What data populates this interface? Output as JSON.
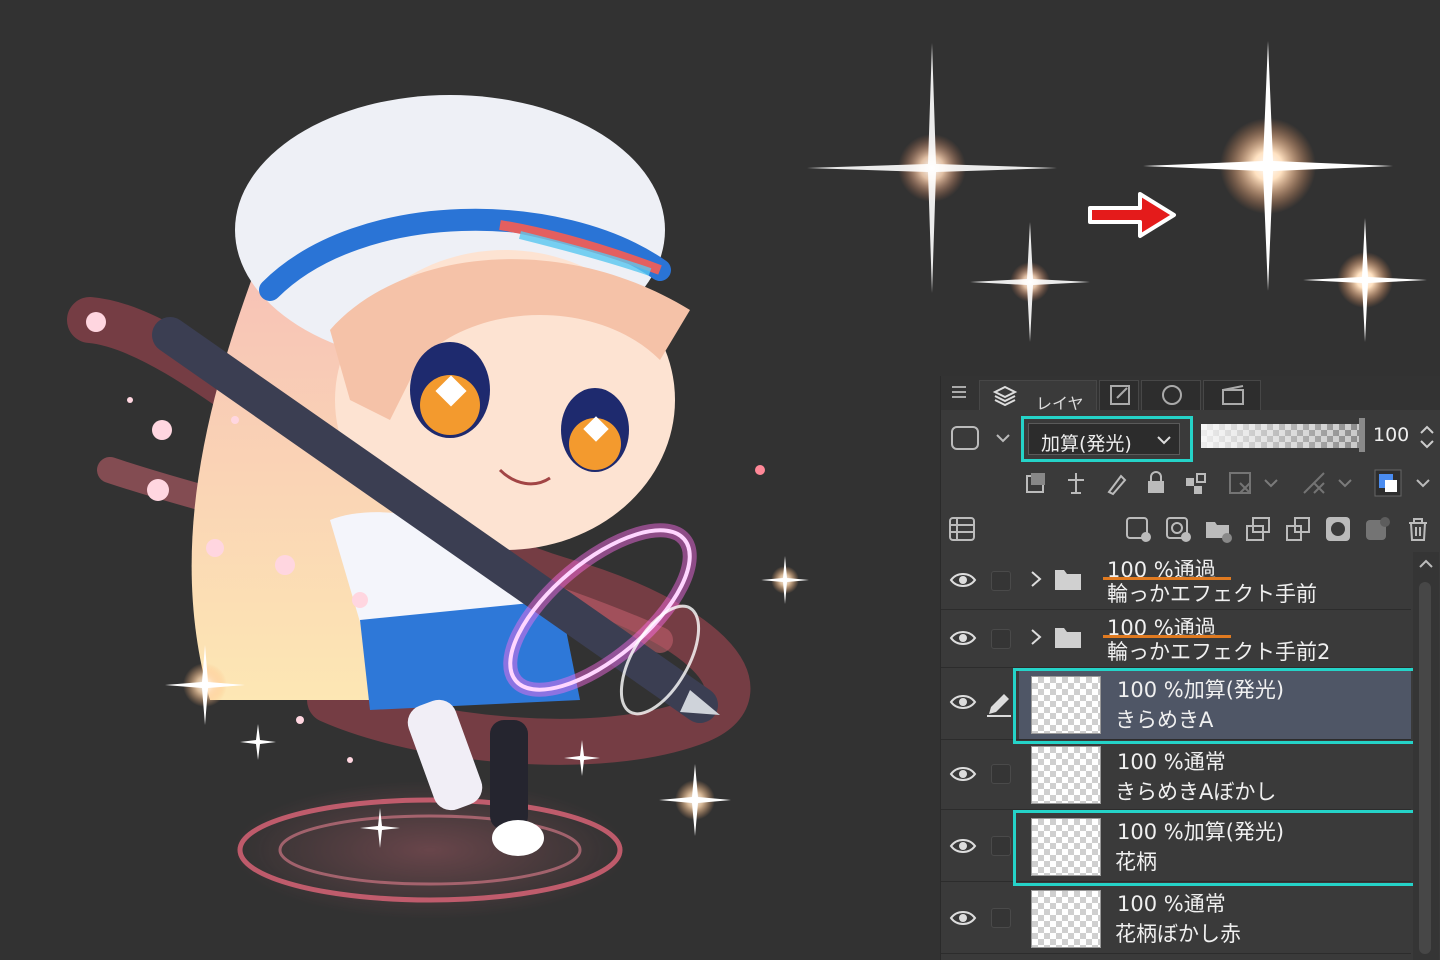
{
  "panel": {
    "tabs": [
      {
        "label": "レイヤー",
        "icon": "layers-icon"
      },
      {
        "label": "",
        "icon": "edit-icon"
      },
      {
        "label": "",
        "icon": "navigator-icon"
      },
      {
        "label": "",
        "icon": "timeline-icon"
      }
    ],
    "blend_mode": "加算(発光)",
    "opacity": "100",
    "colors": {
      "highlight": "#25d3c8",
      "underline": "#e07a20",
      "selected_row": "#4f5666"
    }
  },
  "layers": [
    {
      "type": "folder",
      "line1": "100 %通過",
      "line2": "輪っかエフェクト手前",
      "selected": false,
      "highlighted": false
    },
    {
      "type": "folder",
      "line1": "100 %通過",
      "line2": "輪っかエフェクト手前2",
      "selected": false,
      "highlighted": false
    },
    {
      "type": "raster",
      "line1": "100 %加算(発光)",
      "line2": "きらめきA",
      "selected": true,
      "highlighted": true
    },
    {
      "type": "raster",
      "line1": "100 %通常",
      "line2": "きらめきAぼかし",
      "selected": false,
      "highlighted": false
    },
    {
      "type": "raster",
      "line1": "100 %加算(発光)",
      "line2": "花柄",
      "selected": false,
      "highlighted": true
    },
    {
      "type": "raster",
      "line1": "100 %通常",
      "line2": "花柄ぼかし赤",
      "selected": false,
      "highlighted": false
    }
  ]
}
